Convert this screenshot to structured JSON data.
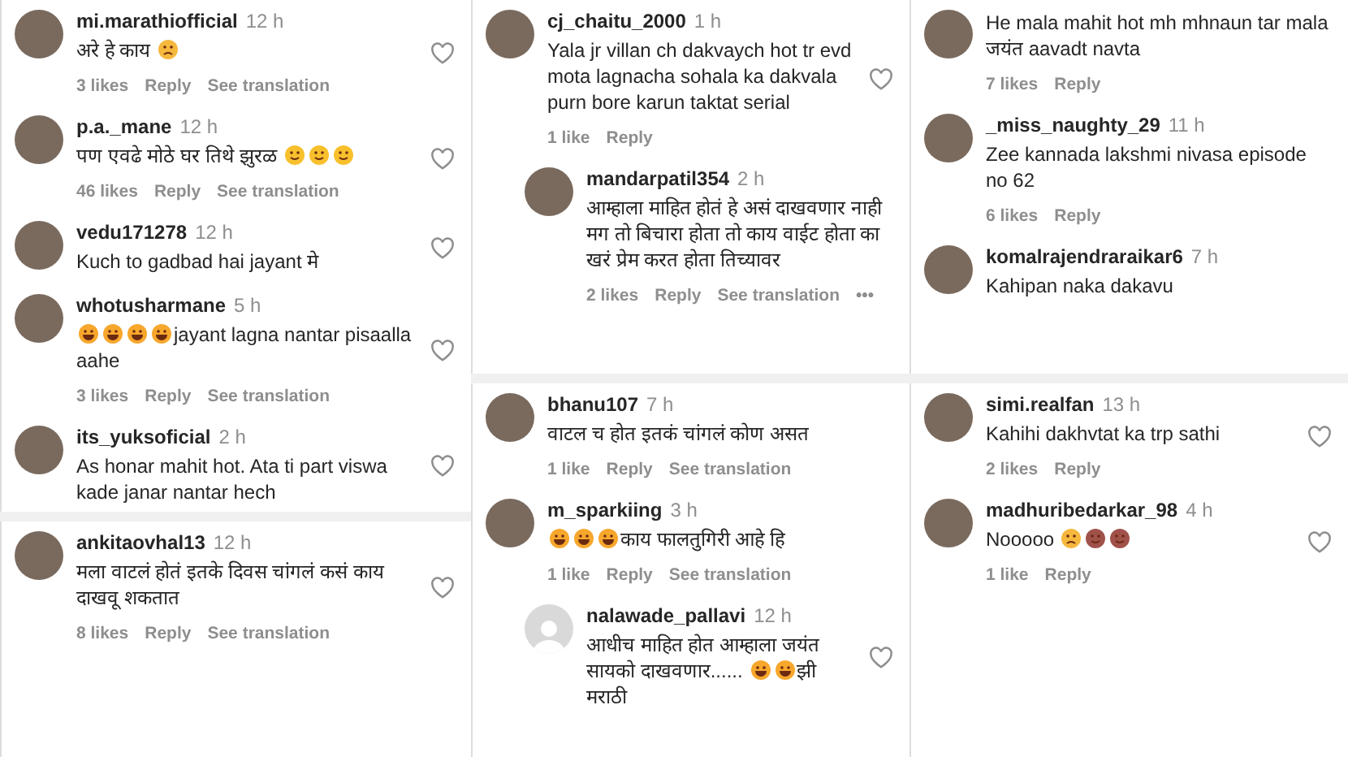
{
  "columns": [
    {
      "panels": [
        {
          "comments": [
            {
              "user": "mi.marathiofficial",
              "time": "12 h",
              "kind": "photo",
              "segments": [
                {
                  "kind": "text",
                  "text": "अरे हे काय"
                },
                {
                  "kind": "sad"
                }
              ],
              "likes": "3 likes",
              "reply": "Reply",
              "translation": "See translation",
              "heart": true
            },
            {
              "user": "p.a._mane",
              "time": "12 h",
              "kind": "photo",
              "segments": [
                {
                  "kind": "text",
                  "text": "पण एवढे मोठे घर तिथे झुरळ"
                },
                {
                  "kind": "smile"
                },
                {
                  "kind": "smile"
                },
                {
                  "kind": "smile"
                }
              ],
              "likes": "46 likes",
              "reply": "Reply",
              "translation": "See translation",
              "heart": true
            },
            {
              "user": "vedu171278",
              "time": "12 h",
              "kind": "photo",
              "segments": [
                {
                  "kind": "text",
                  "text": "Kuch to gadbad hai jayant मे"
                }
              ],
              "heart": true
            },
            {
              "user": "whotusharmane",
              "time": "5 h",
              "kind": "photo",
              "segments": [
                {
                  "kind": "laugh"
                },
                {
                  "kind": "laugh"
                },
                {
                  "kind": "laugh"
                },
                {
                  "kind": "laugh"
                },
                {
                  "kind": "text",
                  "text": "jayant lagna nantar pisaalla aahe"
                }
              ],
              "likes": "3 likes",
              "reply": "Reply",
              "translation": "See translation",
              "heart": true
            },
            {
              "user": "its_yuksoficial",
              "time": "2 h",
              "kind": "photo",
              "segments": [
                {
                  "kind": "text",
                  "text": "As honar mahit hot. Ata ti part viswa kade janar nantar hech"
                }
              ],
              "heart": true
            }
          ]
        },
        {
          "comments": [
            {
              "user": "ankitaovhal13",
              "time": "12 h",
              "kind": "photo",
              "segments": [
                {
                  "kind": "text",
                  "text": "मला वाटलं होतं इतके दिवस चांगलं कसं काय दाखवू शकतात"
                }
              ],
              "likes": "8 likes",
              "reply": "Reply",
              "translation": "See translation",
              "heart": true
            }
          ]
        }
      ]
    },
    {
      "panels": [
        {
          "comments": [
            {
              "user": "cj_chaitu_2000",
              "time": "1 h",
              "kind": "photo",
              "segments": [
                {
                  "kind": "text",
                  "text": "Yala jr villan ch dakvaych hot tr evd mota lagnacha sohala ka dakvala purn bore karun taktat serial"
                }
              ],
              "likes": "1 like",
              "reply": "Reply",
              "heart": true
            },
            {
              "user": "mandarpatil354",
              "time": "2 h",
              "kind": "photo",
              "indent": true,
              "segments": [
                {
                  "kind": "text",
                  "text": "आम्हाला माहित होतं हे असं दाखवणार नाही मग तो बिचारा होता तो काय वाईट होता का खरं प्रेम करत होता तिच्यावर"
                }
              ],
              "likes": "2 likes",
              "reply": "Reply",
              "translation": "See translation",
              "more": "•••"
            }
          ]
        },
        {
          "comments": [
            {
              "user": "bhanu107",
              "time": "7 h",
              "kind": "photo",
              "segments": [
                {
                  "kind": "text",
                  "text": "वाटल च होत इतकं चांगलं कोण असत"
                }
              ],
              "likes": "1 like",
              "reply": "Reply",
              "translation": "See translation"
            },
            {
              "user": "m_sparkiing",
              "time": "3 h",
              "kind": "photo",
              "segments": [
                {
                  "kind": "laugh"
                },
                {
                  "kind": "laugh"
                },
                {
                  "kind": "laugh"
                },
                {
                  "kind": "text",
                  "text": "काय फालतुगिरी आहे हि"
                }
              ],
              "likes": "1 like",
              "reply": "Reply",
              "translation": "See translation"
            },
            {
              "user": "nalawade_pallavi",
              "time": "12 h",
              "kind": "default",
              "indent": true,
              "segments": [
                {
                  "kind": "text",
                  "text": "आधीच माहित होत आम्हाला जयंत सायको दाखवणार......"
                },
                {
                  "kind": "laugh"
                },
                {
                  "kind": "laugh"
                },
                {
                  "kind": "text",
                  "text": "झी मराठी"
                }
              ],
              "heart": true
            }
          ]
        }
      ]
    },
    {
      "panels": [
        {
          "comments": [
            {
              "kind": "photo",
              "segments": [
                {
                  "kind": "text",
                  "text": "He mala mahit hot mh mhnaun tar mala जयंत aavadt navta"
                }
              ],
              "likes": "7 likes",
              "reply": "Reply"
            },
            {
              "user": "_miss_naughty_29",
              "time": "11 h",
              "kind": "photo",
              "segments": [
                {
                  "kind": "text",
                  "text": "Zee kannada lakshmi nivasa episode no 62"
                }
              ],
              "likes": "6 likes",
              "reply": "Reply"
            },
            {
              "user": "komalrajendraraikar6",
              "time": "7 h",
              "kind": "photo",
              "segments": [
                {
                  "kind": "text",
                  "text": "Kahipan naka dakavu"
                }
              ]
            }
          ]
        },
        {
          "comments": [
            {
              "user": "simi.realfan",
              "time": "13 h",
              "kind": "photo",
              "segments": [
                {
                  "kind": "text",
                  "text": "Kahihi dakhvtat ka trp sathi"
                }
              ],
              "likes": "2 likes",
              "reply": "Reply",
              "heart": true
            },
            {
              "user": "madhuribedarkar_98",
              "time": "4 h",
              "kind": "photo",
              "segments": [
                {
                  "kind": "text",
                  "text": "Nooooo"
                },
                {
                  "kind": "sad"
                },
                {
                  "kind": "monkey"
                },
                {
                  "kind": "monkey"
                }
              ],
              "likes": "1 like",
              "reply": "Reply",
              "heart": true
            }
          ]
        }
      ]
    }
  ]
}
